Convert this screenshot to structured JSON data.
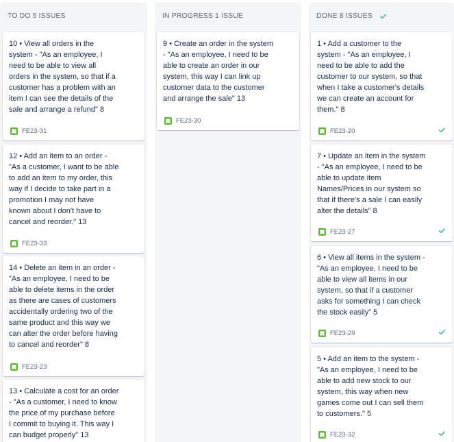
{
  "columns": {
    "todo": {
      "title": "TO DO 5 ISSUES"
    },
    "in_progress": {
      "title": "IN PROGRESS 1 ISSUE"
    },
    "done": {
      "title": "DONE 8 ISSUES",
      "icon": "check-icon"
    }
  },
  "cards": {
    "todo": [
      {
        "title": "10 • View all orders in the\nsystem - \"As an employee, I\nneed to be able to view all\norders in the system, so that if a\ncustomer has a problem with an\nitem I can see the details of the\nsale and arrange a refund\" 8",
        "key": "FE23-31"
      },
      {
        "title": "12 • Add an item to an order -\n\"As a customer, I want to be able\nto add an item to my order, this\nway if I decide to take part in a\npromotion I may not have\nknown about I don't have to\ncancel and reorder.\" 13",
        "key": "FE23-33"
      },
      {
        "title": "14 • Delete an item in an order -\n\"As an employee, I need to be\nable to delete items in the order\nas there are cases of customers\naccidentally ordering two of the\nsame product and this way we\ncan alter the order before having\nto cancel and reorder\" 8",
        "key": "FE23-23"
      },
      {
        "title": "13 • Calculate a cost for an order\n- \"As a customer, I need to know\nthe price of my purchase before\nI commit to buying it. This way I\ncan budget properly\" 13",
        "key": ""
      }
    ],
    "in_progress": [
      {
        "title": "9 • Create an order in the system\n- \"As an employee, I need to be\nable to create an order in our\nsystem, this way I can link up\ncustomer data to the customer\nand arrange the sale\" 13",
        "key": "FE23-30"
      }
    ],
    "done": [
      {
        "title": "1 • Add a customer to the\nsystem - \"As an employee, I\nneed to be able to add the\ncustomer to our system, so that\nwhen I take a customer's details\nwe can create an account for\nthem.\" 8",
        "key": "FE23-20"
      },
      {
        "title": "7 • Update an item in the system\n- \"As an employee, I need to be\nable to update item\nNames/Prices in our system so\nthat if there's a sale I can easily\nalter the details\" 8",
        "key": "FE23-27"
      },
      {
        "title": "6 • View all items in the system -\n\"As an employee, I need to be\nable to view all items in our\nsystem, so that if a customer\nasks for something I can check\nthe stock easily\" 5",
        "key": "FE23-29"
      },
      {
        "title": "5 • Add an item to the system -\n\"As an employee, I need to be\nable to add new stock to our\nsystem, this way when new\ngames come out I can sell them\nto customers.\" 5",
        "key": "FE23-32"
      }
    ]
  },
  "colors": {
    "story": "#63ba3c",
    "done_check": "#36b37e",
    "column_bg": "#f4f5f7"
  },
  "icons": {
    "story": "bookmark-icon",
    "resolved": "check-icon"
  }
}
